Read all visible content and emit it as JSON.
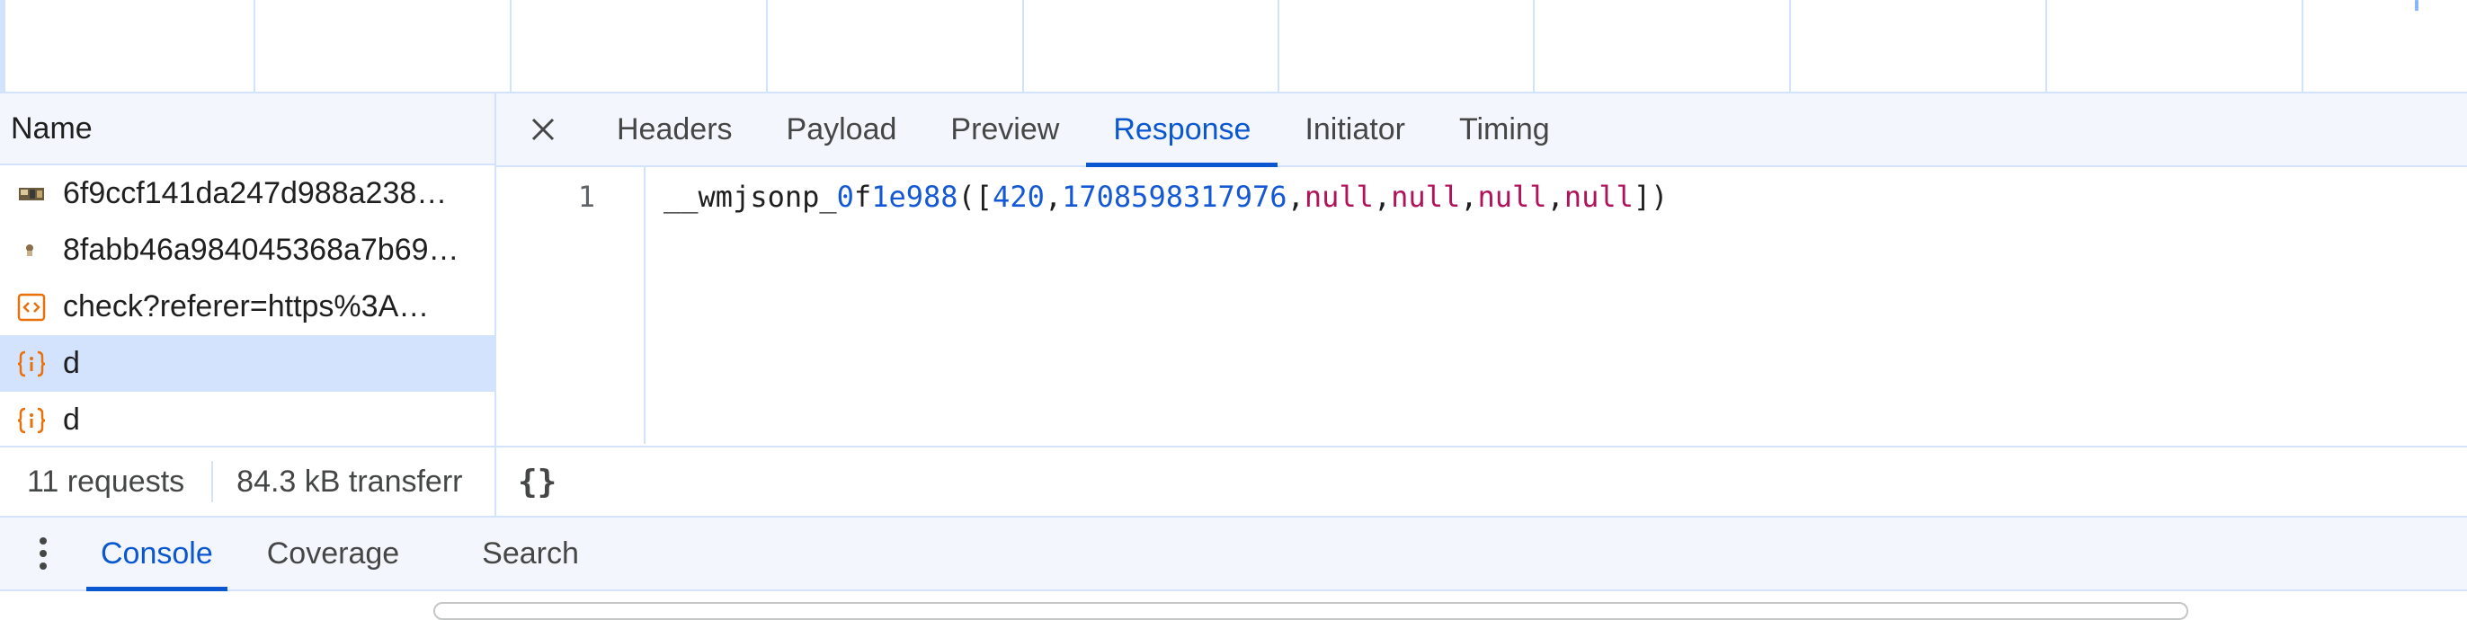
{
  "request_list": {
    "header": "Name",
    "items": [
      {
        "name": "6f9ccf141da247d988a238…",
        "icon": "image-thumbnail-icon",
        "selected": false
      },
      {
        "name": "8fabb46a984045368a7b69…",
        "icon": "image-thumbnail-icon",
        "selected": false
      },
      {
        "name": "check?referer=https%3A…",
        "icon": "document-code-icon",
        "selected": false
      },
      {
        "name": "d",
        "icon": "script-braces-icon",
        "selected": true
      },
      {
        "name": "d",
        "icon": "script-braces-icon",
        "selected": false
      }
    ]
  },
  "detail": {
    "tabs": [
      {
        "label": "Headers",
        "active": false
      },
      {
        "label": "Payload",
        "active": false
      },
      {
        "label": "Preview",
        "active": false
      },
      {
        "label": "Response",
        "active": true
      },
      {
        "label": "Initiator",
        "active": false
      },
      {
        "label": "Timing",
        "active": false
      }
    ],
    "response": {
      "line_number": "1",
      "tokens": [
        {
          "text": "__wmjsonp_",
          "kind": "plain"
        },
        {
          "text": "0",
          "kind": "num"
        },
        {
          "text": "f",
          "kind": "plain"
        },
        {
          "text": "1e988",
          "kind": "num"
        },
        {
          "text": "([",
          "kind": "plain"
        },
        {
          "text": "420",
          "kind": "num"
        },
        {
          "text": ",",
          "kind": "plain"
        },
        {
          "text": "1708598317976",
          "kind": "num"
        },
        {
          "text": ",",
          "kind": "plain"
        },
        {
          "text": "null",
          "kind": "null"
        },
        {
          "text": ",",
          "kind": "plain"
        },
        {
          "text": "null",
          "kind": "null"
        },
        {
          "text": ",",
          "kind": "plain"
        },
        {
          "text": "null",
          "kind": "null"
        },
        {
          "text": ",",
          "kind": "plain"
        },
        {
          "text": "null",
          "kind": "null"
        },
        {
          "text": "])",
          "kind": "plain"
        }
      ]
    }
  },
  "status": {
    "requests": "11 requests",
    "transferred": "84.3 kB transferr",
    "pretty_print": "{}"
  },
  "drawer": {
    "tabs": [
      {
        "label": "Console",
        "active": true
      },
      {
        "label": "Coverage",
        "active": false
      },
      {
        "label": "Search",
        "active": false
      }
    ]
  },
  "colors": {
    "accent": "#0b57d0",
    "selected_row": "#d3e3fd",
    "header_bg": "#f3f6fc",
    "border": "#d3e3fd",
    "number_token": "#1558d6",
    "null_token": "#b0135a",
    "icon_orange": "#e8710a"
  }
}
